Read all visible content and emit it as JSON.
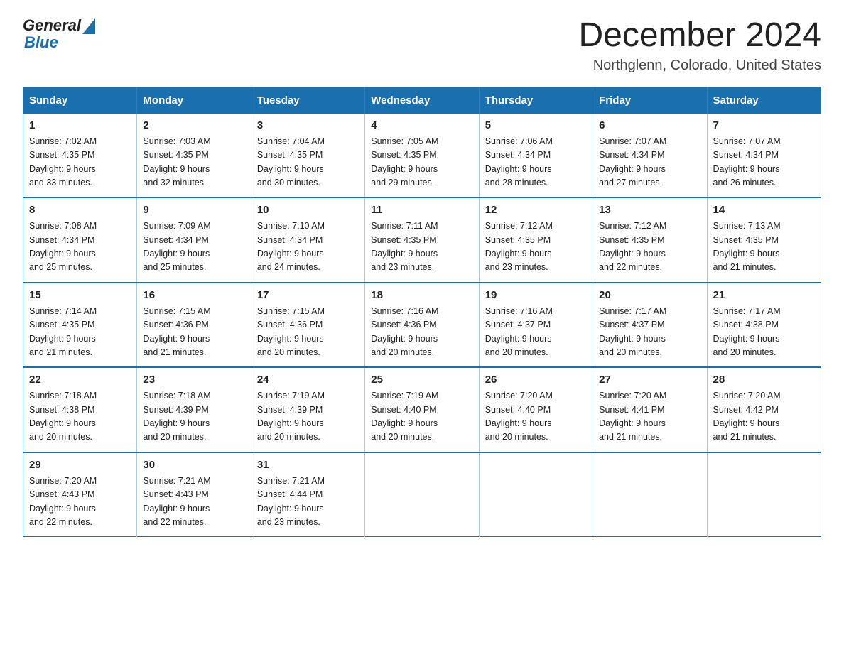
{
  "logo": {
    "general": "General",
    "arrow": "▲",
    "blue": "Blue"
  },
  "title": "December 2024",
  "location": "Northglenn, Colorado, United States",
  "days_of_week": [
    "Sunday",
    "Monday",
    "Tuesday",
    "Wednesday",
    "Thursday",
    "Friday",
    "Saturday"
  ],
  "weeks": [
    [
      {
        "day": "1",
        "sunrise": "7:02 AM",
        "sunset": "4:35 PM",
        "daylight": "9 hours and 33 minutes."
      },
      {
        "day": "2",
        "sunrise": "7:03 AM",
        "sunset": "4:35 PM",
        "daylight": "9 hours and 32 minutes."
      },
      {
        "day": "3",
        "sunrise": "7:04 AM",
        "sunset": "4:35 PM",
        "daylight": "9 hours and 30 minutes."
      },
      {
        "day": "4",
        "sunrise": "7:05 AM",
        "sunset": "4:35 PM",
        "daylight": "9 hours and 29 minutes."
      },
      {
        "day": "5",
        "sunrise": "7:06 AM",
        "sunset": "4:34 PM",
        "daylight": "9 hours and 28 minutes."
      },
      {
        "day": "6",
        "sunrise": "7:07 AM",
        "sunset": "4:34 PM",
        "daylight": "9 hours and 27 minutes."
      },
      {
        "day": "7",
        "sunrise": "7:07 AM",
        "sunset": "4:34 PM",
        "daylight": "9 hours and 26 minutes."
      }
    ],
    [
      {
        "day": "8",
        "sunrise": "7:08 AM",
        "sunset": "4:34 PM",
        "daylight": "9 hours and 25 minutes."
      },
      {
        "day": "9",
        "sunrise": "7:09 AM",
        "sunset": "4:34 PM",
        "daylight": "9 hours and 25 minutes."
      },
      {
        "day": "10",
        "sunrise": "7:10 AM",
        "sunset": "4:34 PM",
        "daylight": "9 hours and 24 minutes."
      },
      {
        "day": "11",
        "sunrise": "7:11 AM",
        "sunset": "4:35 PM",
        "daylight": "9 hours and 23 minutes."
      },
      {
        "day": "12",
        "sunrise": "7:12 AM",
        "sunset": "4:35 PM",
        "daylight": "9 hours and 23 minutes."
      },
      {
        "day": "13",
        "sunrise": "7:12 AM",
        "sunset": "4:35 PM",
        "daylight": "9 hours and 22 minutes."
      },
      {
        "day": "14",
        "sunrise": "7:13 AM",
        "sunset": "4:35 PM",
        "daylight": "9 hours and 21 minutes."
      }
    ],
    [
      {
        "day": "15",
        "sunrise": "7:14 AM",
        "sunset": "4:35 PM",
        "daylight": "9 hours and 21 minutes."
      },
      {
        "day": "16",
        "sunrise": "7:15 AM",
        "sunset": "4:36 PM",
        "daylight": "9 hours and 21 minutes."
      },
      {
        "day": "17",
        "sunrise": "7:15 AM",
        "sunset": "4:36 PM",
        "daylight": "9 hours and 20 minutes."
      },
      {
        "day": "18",
        "sunrise": "7:16 AM",
        "sunset": "4:36 PM",
        "daylight": "9 hours and 20 minutes."
      },
      {
        "day": "19",
        "sunrise": "7:16 AM",
        "sunset": "4:37 PM",
        "daylight": "9 hours and 20 minutes."
      },
      {
        "day": "20",
        "sunrise": "7:17 AM",
        "sunset": "4:37 PM",
        "daylight": "9 hours and 20 minutes."
      },
      {
        "day": "21",
        "sunrise": "7:17 AM",
        "sunset": "4:38 PM",
        "daylight": "9 hours and 20 minutes."
      }
    ],
    [
      {
        "day": "22",
        "sunrise": "7:18 AM",
        "sunset": "4:38 PM",
        "daylight": "9 hours and 20 minutes."
      },
      {
        "day": "23",
        "sunrise": "7:18 AM",
        "sunset": "4:39 PM",
        "daylight": "9 hours and 20 minutes."
      },
      {
        "day": "24",
        "sunrise": "7:19 AM",
        "sunset": "4:39 PM",
        "daylight": "9 hours and 20 minutes."
      },
      {
        "day": "25",
        "sunrise": "7:19 AM",
        "sunset": "4:40 PM",
        "daylight": "9 hours and 20 minutes."
      },
      {
        "day": "26",
        "sunrise": "7:20 AM",
        "sunset": "4:40 PM",
        "daylight": "9 hours and 20 minutes."
      },
      {
        "day": "27",
        "sunrise": "7:20 AM",
        "sunset": "4:41 PM",
        "daylight": "9 hours and 21 minutes."
      },
      {
        "day": "28",
        "sunrise": "7:20 AM",
        "sunset": "4:42 PM",
        "daylight": "9 hours and 21 minutes."
      }
    ],
    [
      {
        "day": "29",
        "sunrise": "7:20 AM",
        "sunset": "4:43 PM",
        "daylight": "9 hours and 22 minutes."
      },
      {
        "day": "30",
        "sunrise": "7:21 AM",
        "sunset": "4:43 PM",
        "daylight": "9 hours and 22 minutes."
      },
      {
        "day": "31",
        "sunrise": "7:21 AM",
        "sunset": "4:44 PM",
        "daylight": "9 hours and 23 minutes."
      },
      null,
      null,
      null,
      null
    ]
  ],
  "labels": {
    "sunrise": "Sunrise:",
    "sunset": "Sunset:",
    "daylight": "Daylight:"
  }
}
